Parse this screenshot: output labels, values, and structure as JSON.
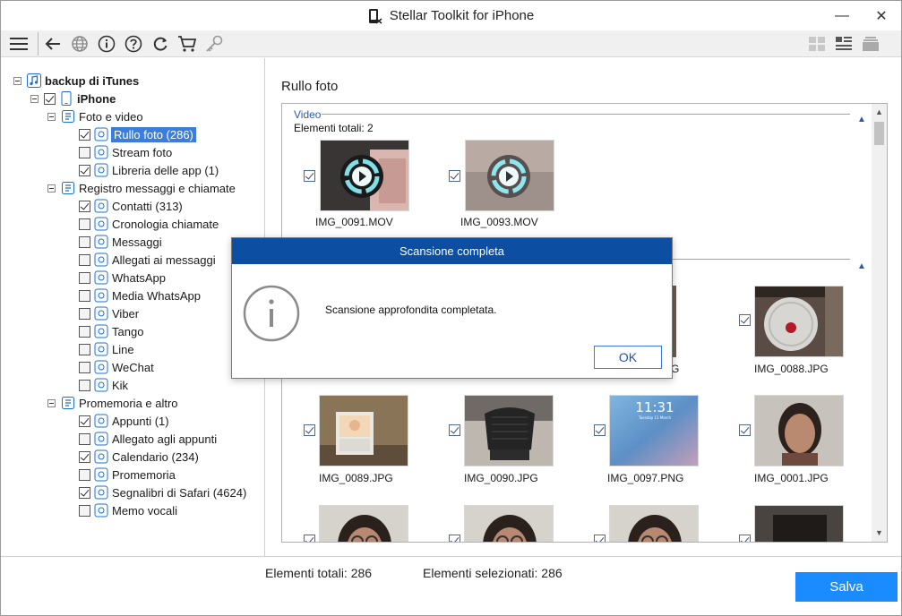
{
  "window": {
    "title": "Stellar Toolkit for iPhone",
    "minimize_glyph": "—",
    "close_glyph": "✕"
  },
  "toolbar": {
    "icons": [
      "menu-icon",
      "back-icon",
      "globe-icon",
      "info-icon",
      "help-icon",
      "refresh-icon",
      "cart-icon",
      "key-icon",
      "grid-view-icon",
      "list-view-icon",
      "stack-view-icon"
    ]
  },
  "tree": {
    "root": "backup di iTunes",
    "device": "iPhone",
    "groups": [
      {
        "label": "Foto e video",
        "items": [
          {
            "label": "Rullo foto (286)",
            "checked": true,
            "selected": true
          },
          {
            "label": "Stream foto",
            "checked": false
          },
          {
            "label": "Libreria delle app (1)",
            "checked": true
          }
        ]
      },
      {
        "label": "Registro messaggi e chiamate",
        "items": [
          {
            "label": "Contatti (313)",
            "checked": true
          },
          {
            "label": "Cronologia chiamate",
            "checked": false
          },
          {
            "label": "Messaggi",
            "checked": false
          },
          {
            "label": "Allegati ai messaggi",
            "checked": false
          },
          {
            "label": "WhatsApp",
            "checked": false
          },
          {
            "label": "Media WhatsApp",
            "checked": false
          },
          {
            "label": "Viber",
            "checked": false
          },
          {
            "label": "Tango",
            "checked": false
          },
          {
            "label": "Line",
            "checked": false
          },
          {
            "label": "WeChat",
            "checked": false
          },
          {
            "label": "Kik",
            "checked": false
          }
        ]
      },
      {
        "label": "Promemoria e altro",
        "items": [
          {
            "label": "Appunti  (1)",
            "checked": true
          },
          {
            "label": "Allegato agli appunti",
            "checked": false
          },
          {
            "label": "Calendario (234)",
            "checked": true
          },
          {
            "label": "Promemoria",
            "checked": false
          },
          {
            "label": "Segnalibri di Safari (4624)",
            "checked": true
          },
          {
            "label": "Memo vocali",
            "checked": false
          }
        ]
      }
    ]
  },
  "content": {
    "title": "Rullo foto",
    "video_section": {
      "label": "Video",
      "count": "Elementi totali: 2",
      "items": [
        "IMG_0091.MOV",
        "IMG_0093.MOV"
      ]
    },
    "photo_items": [
      {
        "name": "IMG_0088.JPG"
      },
      {
        "name": "IMG_0089.JPG"
      },
      {
        "name": "IMG_0090.JPG"
      },
      {
        "name": "IMG_0097.PNG"
      },
      {
        "name": "IMG_0001.JPG"
      }
    ],
    "partial_label_fragment": "G",
    "lockscreen_time": "11:31",
    "lockscreen_date": "Tuesday 11 March"
  },
  "status": {
    "total": "Elementi totali: 286",
    "selected": "Elementi selezionati: 286",
    "save_label": "Salva"
  },
  "dialog": {
    "title": "Scansione completa",
    "message": "Scansione approfondita completata.",
    "ok_label": "OK"
  },
  "colors": {
    "accent": "#1a8cff",
    "dialog_header": "#0b4ea2",
    "selection": "#3b7ddd"
  }
}
